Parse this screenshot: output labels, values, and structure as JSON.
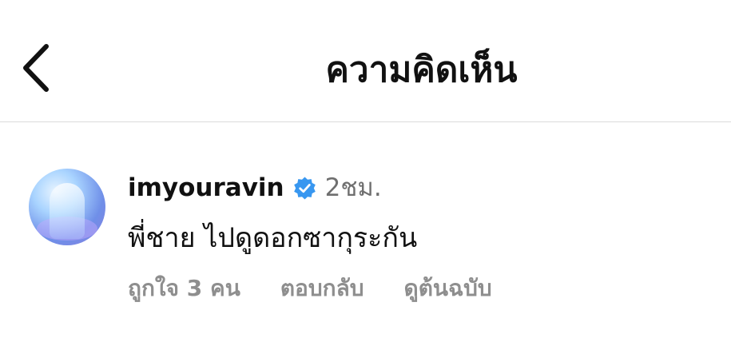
{
  "header": {
    "back_icon": "chevron-left-icon",
    "title": "ความคิดเห็น"
  },
  "comment": {
    "avatar_icon": "user-avatar",
    "username": "imyouravin",
    "verified_icon": "verified-badge-icon",
    "verified_color": "#3897f0",
    "time_ago": "2ชม.",
    "text": "พี่ชาย ไปดูดอกซากุระกัน",
    "actions": {
      "likes": "ถูกใจ 3 คน",
      "reply": "ตอบกลับ",
      "see_original": "ดูต้นฉบับ"
    }
  }
}
